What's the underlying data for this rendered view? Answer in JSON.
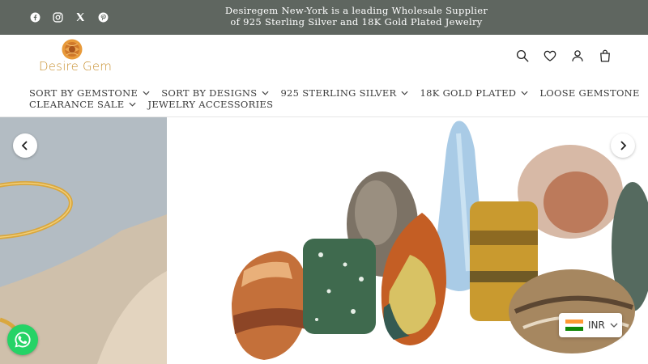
{
  "announcement": {
    "line1": "Desiregem New-York is a leading Wholesale Supplier",
    "line2": "of 925 Sterling Silver and 18K Gold Plated Jewelry"
  },
  "social_icons": [
    "facebook-icon",
    "instagram-icon",
    "x-icon",
    "pinterest-icon"
  ],
  "logo": {
    "text": "Desire Gem"
  },
  "header_icons": [
    "search-icon",
    "heart-icon",
    "account-icon",
    "cart-icon"
  ],
  "nav": {
    "row1": [
      {
        "label": "SORT BY GEMSTONE",
        "dropdown": true
      },
      {
        "label": "SORT BY DESIGNS",
        "dropdown": true
      },
      {
        "label": "925 STERLING SILVER",
        "dropdown": true
      },
      {
        "label": "18K GOLD PLATED",
        "dropdown": true
      },
      {
        "label": "LOOSE GEMSTONE",
        "dropdown": false
      }
    ],
    "row2": [
      {
        "label": "CLEARANCE SALE",
        "dropdown": true
      },
      {
        "label": "JEWELRY ACCESSORIES",
        "dropdown": false
      }
    ]
  },
  "currency": {
    "code": "INR"
  },
  "colors": {
    "topbar": "#5f6660",
    "logo_gold": "#c8902f",
    "whatsapp": "#25d366"
  }
}
